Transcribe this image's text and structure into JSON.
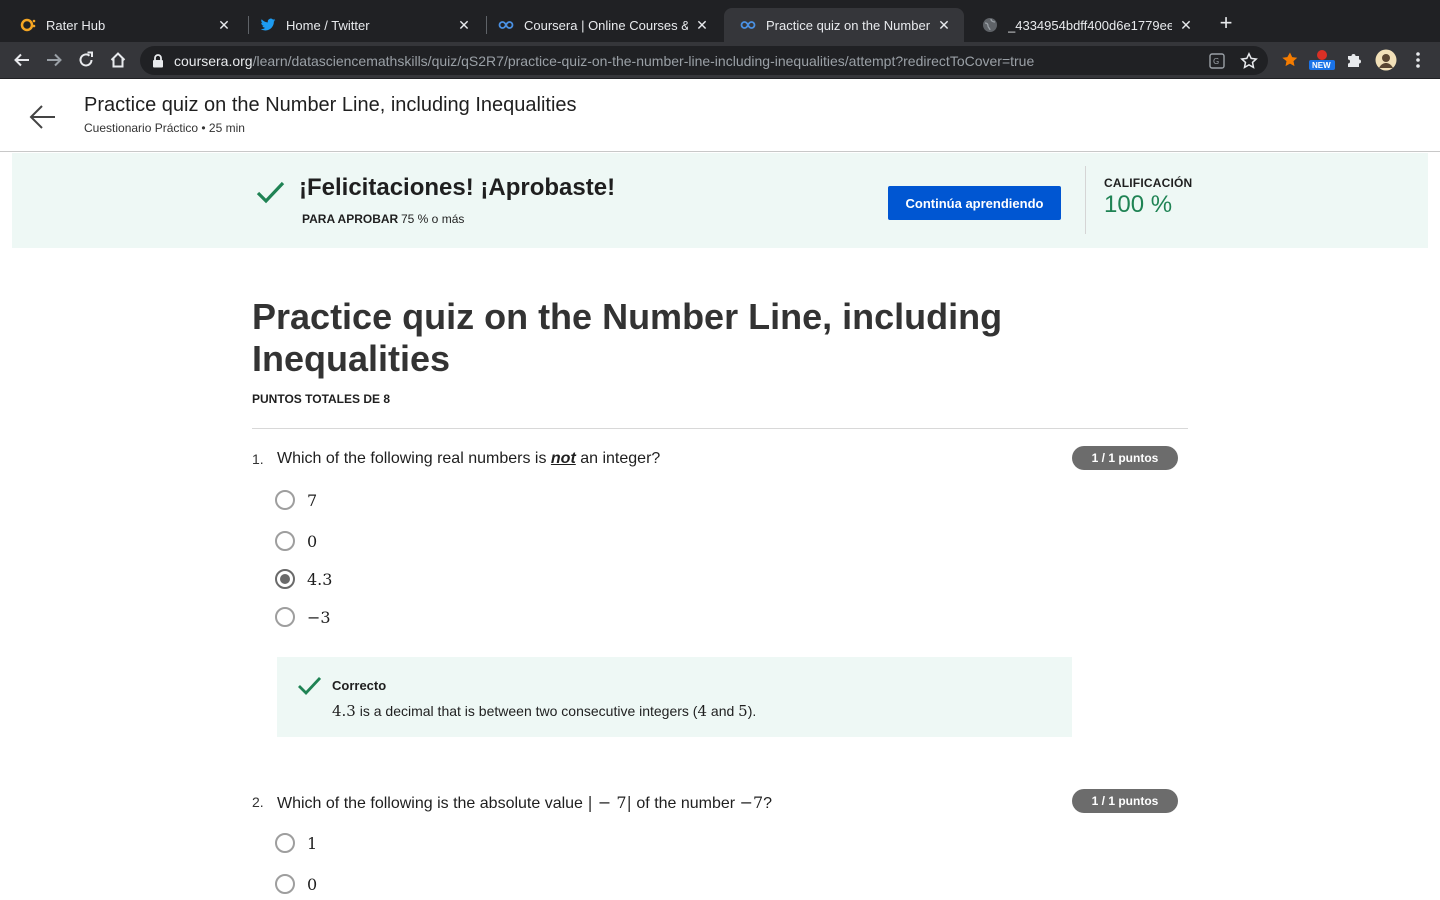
{
  "browser": {
    "tabs": [
      {
        "title": "Rater Hub",
        "icon": "rater-hub-favicon",
        "active": false
      },
      {
        "title": "Home / Twitter",
        "icon": "twitter-bird-icon",
        "active": false
      },
      {
        "title": "Coursera | Online Courses & C",
        "icon": "coursera-infinity-icon",
        "active": false
      },
      {
        "title": "Practice quiz on the Number Li",
        "icon": "coursera-infinity-icon",
        "active": true
      },
      {
        "title": "_4334954bdff400d6e1779eef",
        "icon": "globe-icon",
        "active": false
      }
    ],
    "url_host": "coursera.org",
    "url_path": "/learn/datasciencemathskills/quiz/qS2R7/practice-quiz-on-the-number-line-including-inequalities/attempt?redirectToCover=true",
    "new_badge": "NEW"
  },
  "header": {
    "title": "Practice quiz on the Number Line, including Inequalities",
    "subtitle": "Cuestionario Práctico • 25 min"
  },
  "banner": {
    "title": "¡Felicitaciones! ¡Aprobaste!",
    "pass_label": "PARA APROBAR",
    "pass_value": "75 % o más",
    "continue_label": "Continúa aprendiendo",
    "grade_label": "CALIFICACIÓN",
    "grade_value": "100 %",
    "accent_color": "#1f8354",
    "button_color": "#0056d2"
  },
  "quiz": {
    "title": "Practice quiz on the Number Line, including Inequalities",
    "total_points": "PUNTOS TOTALES DE 8",
    "questions": [
      {
        "number": "1.",
        "text_before": "Which of the following real numbers is ",
        "text_emphasis": "not",
        "text_after": " an integer?",
        "points": "1 / 1 puntos",
        "options": [
          "7",
          "0",
          "4.3",
          "−3"
        ],
        "selected_index": 2,
        "feedback": {
          "title": "Correcto",
          "num1": "4.3",
          "text1": " is a decimal that is between two consecutive integers (",
          "num2": "4",
          "text2": " and ",
          "num3": "5",
          "text3": ")."
        }
      },
      {
        "number": "2.",
        "text_before": "Which of the following is the absolute value ",
        "math1": "| − 7|",
        "text_middle": " of the number ",
        "math2": "−7",
        "text_after": "?",
        "points": "1 / 1 puntos",
        "options": [
          "1",
          "0"
        ]
      }
    ]
  }
}
